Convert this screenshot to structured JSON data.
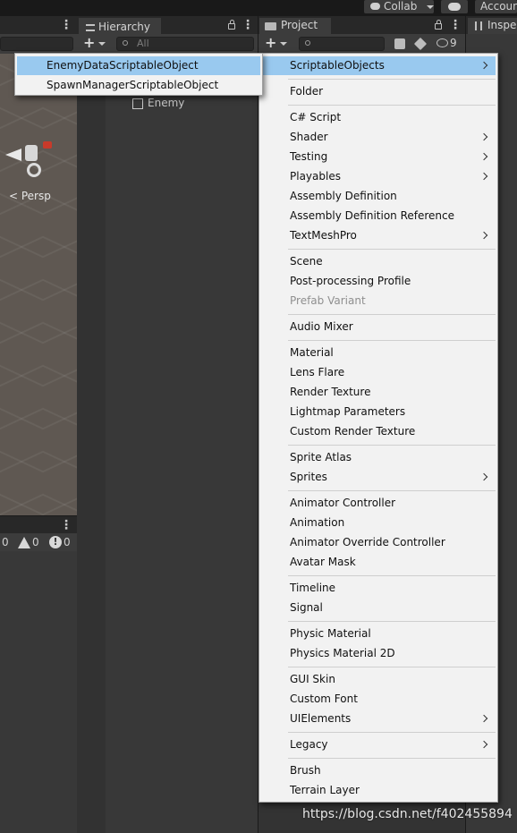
{
  "toolbar": {
    "collab_label": "Collab",
    "account_label": "Account",
    "collab_icon": "cloud-check-icon",
    "cloud_icon": "cloud-icon"
  },
  "scene": {
    "persp_label": "< Persp"
  },
  "console": {
    "log_count": "0",
    "warning_count": "0",
    "error_count": "0"
  },
  "hierarchy": {
    "tab_label": "Hierarchy",
    "search_placeholder": "All",
    "items": [
      "Enemy"
    ]
  },
  "project": {
    "tab_label": "Project",
    "hidden_count": "9"
  },
  "inspector": {
    "tab_label": "Inspector"
  },
  "submenu": {
    "items": [
      {
        "label": "EnemyDataScriptableObject",
        "highlighted": true
      },
      {
        "label": "SpawnManagerScriptableObject",
        "highlighted": false
      }
    ]
  },
  "create_menu": {
    "groups": [
      [
        {
          "label": "ScriptableObjects",
          "submenu": true,
          "highlighted": true
        }
      ],
      [
        {
          "label": "Folder"
        }
      ],
      [
        {
          "label": "C# Script"
        },
        {
          "label": "Shader",
          "submenu": true
        },
        {
          "label": "Testing",
          "submenu": true
        },
        {
          "label": "Playables",
          "submenu": true
        },
        {
          "label": "Assembly Definition"
        },
        {
          "label": "Assembly Definition Reference"
        },
        {
          "label": "TextMeshPro",
          "submenu": true
        }
      ],
      [
        {
          "label": "Scene"
        },
        {
          "label": "Post-processing Profile"
        },
        {
          "label": "Prefab Variant",
          "disabled": true
        }
      ],
      [
        {
          "label": "Audio Mixer"
        }
      ],
      [
        {
          "label": "Material"
        },
        {
          "label": "Lens Flare"
        },
        {
          "label": "Render Texture"
        },
        {
          "label": "Lightmap Parameters"
        },
        {
          "label": "Custom Render Texture"
        }
      ],
      [
        {
          "label": "Sprite Atlas"
        },
        {
          "label": "Sprites",
          "submenu": true
        }
      ],
      [
        {
          "label": "Animator Controller"
        },
        {
          "label": "Animation"
        },
        {
          "label": "Animator Override Controller"
        },
        {
          "label": "Avatar Mask"
        }
      ],
      [
        {
          "label": "Timeline"
        },
        {
          "label": "Signal"
        }
      ],
      [
        {
          "label": "Physic Material"
        },
        {
          "label": "Physics Material 2D"
        }
      ],
      [
        {
          "label": "GUI Skin"
        },
        {
          "label": "Custom Font"
        },
        {
          "label": "UIElements",
          "submenu": true
        }
      ],
      [
        {
          "label": "Legacy",
          "submenu": true
        }
      ],
      [
        {
          "label": "Brush"
        },
        {
          "label": "Terrain Layer"
        }
      ]
    ]
  },
  "watermark": "https://blog.csdn.net/f402455894"
}
